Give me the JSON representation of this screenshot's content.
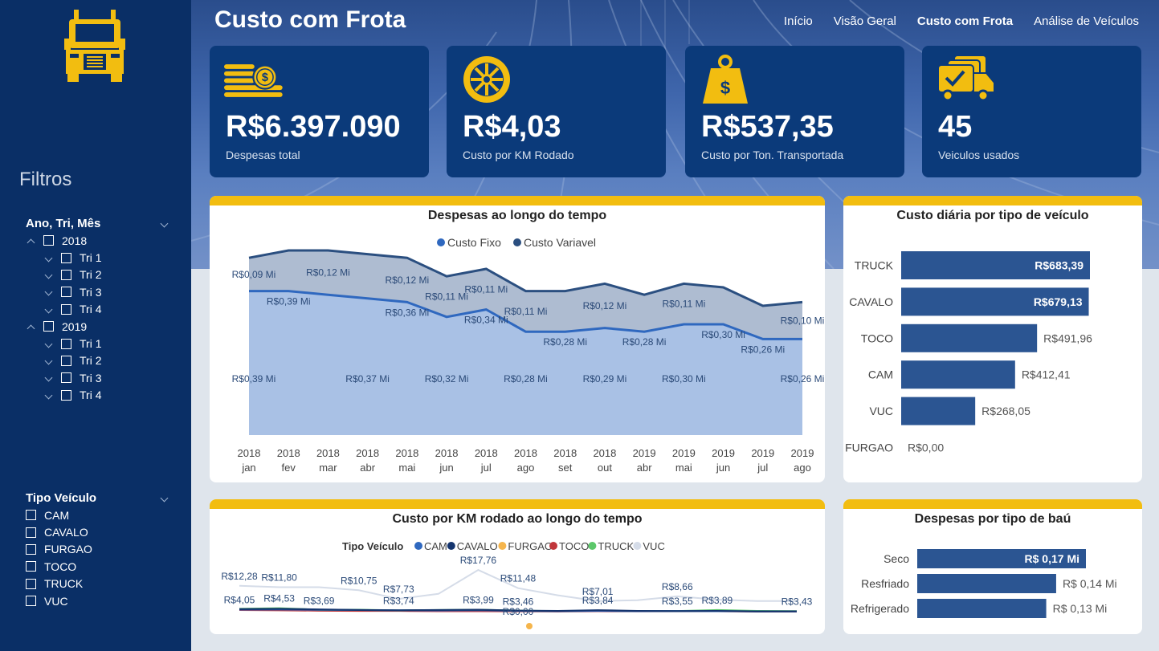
{
  "header": {
    "title": "Custo com Frota",
    "nav": [
      "Início",
      "Visão Geral",
      "Custo com Frota",
      "Análise de Veículos"
    ],
    "active_nav": "Custo com Frota"
  },
  "sidebar": {
    "filters_title": "Filtros",
    "date_filter": {
      "label": "Ano, Tri, Mês",
      "years": [
        {
          "label": "2018",
          "quarters": [
            "Tri 1",
            "Tri 2",
            "Tri 3",
            "Tri 4"
          ]
        },
        {
          "label": "2019",
          "quarters": [
            "Tri 1",
            "Tri 2",
            "Tri 3",
            "Tri 4"
          ]
        }
      ]
    },
    "vehicle_filter": {
      "label": "Tipo Veículo",
      "options": [
        "CAM",
        "CAVALO",
        "FURGAO",
        "TOCO",
        "TRUCK",
        "VUC"
      ]
    }
  },
  "kpis": [
    {
      "value": "R$6.397.090",
      "label": "Despesas total",
      "icon": "coins-icon"
    },
    {
      "value": "R$4,03",
      "label": "Custo por KM Rodado",
      "icon": "tire-icon"
    },
    {
      "value": "R$537,35",
      "label": "Custo por Ton. Transportada",
      "icon": "weight-icon"
    },
    {
      "value": "45",
      "label": "Veiculos usados",
      "icon": "trucks-check-icon"
    }
  ],
  "colors": {
    "sidebar": "#0a2f66",
    "kpi_card": "#0b3a7a",
    "accent_bar": "#f2bd10",
    "bar": "#2b5592",
    "custo_fixo": "#2f68bf",
    "custo_variavel": "#2b4f80"
  },
  "chart_data": [
    {
      "type": "area",
      "title": "Despesas ao longo do tempo",
      "legend_position": "top-center",
      "x": [
        "2018 jan",
        "2018 fev",
        "2018 mar",
        "2018 abr",
        "2018 mai",
        "2018 jun",
        "2018 jul",
        "2018 ago",
        "2018 set",
        "2018 out",
        "2019 abr",
        "2019 mai",
        "2019 jun",
        "2019 jul",
        "2019 ago"
      ],
      "x_labels": [
        [
          "2018",
          "jan"
        ],
        [
          "2018",
          "fev"
        ],
        [
          "2018",
          "mar"
        ],
        [
          "2018",
          "abr"
        ],
        [
          "2018",
          "mai"
        ],
        [
          "2018",
          "jun"
        ],
        [
          "2018",
          "jul"
        ],
        [
          "2018",
          "ago"
        ],
        [
          "2018",
          "set"
        ],
        [
          "2018",
          "out"
        ],
        [
          "2019",
          "abr"
        ],
        [
          "2019",
          "mai"
        ],
        [
          "2019",
          "jun"
        ],
        [
          "2019",
          "jul"
        ],
        [
          "2019",
          "ago"
        ]
      ],
      "stacked": true,
      "series": [
        {
          "name": "Custo Fixo",
          "color": "#2f68bf",
          "values": [
            0.39,
            0.39,
            0.38,
            0.37,
            0.36,
            0.32,
            0.34,
            0.28,
            0.28,
            0.29,
            0.28,
            0.3,
            0.3,
            0.26,
            0.26
          ]
        },
        {
          "name": "Custo Variavel",
          "color": "#2b4f80",
          "values": [
            0.09,
            0.11,
            0.12,
            0.12,
            0.12,
            0.11,
            0.11,
            0.11,
            0.11,
            0.12,
            0.1,
            0.11,
            0.1,
            0.09,
            0.1
          ]
        }
      ],
      "data_labels": [
        {
          "series": "Custo Variavel",
          "idx": 0,
          "text": "R$0,09 Mi"
        },
        {
          "series": "Custo Variavel",
          "idx": 2,
          "text": "R$0,12 Mi"
        },
        {
          "series": "Custo Variavel",
          "idx": 4,
          "text": "R$0,12 Mi"
        },
        {
          "series": "Custo Variavel",
          "idx": 5,
          "text": "R$0,11 Mi"
        },
        {
          "series": "Custo Variavel",
          "idx": 6,
          "text": "R$0,11 Mi"
        },
        {
          "series": "Custo Variavel",
          "idx": 7,
          "text": "R$0,11 Mi"
        },
        {
          "series": "Custo Variavel",
          "idx": 9,
          "text": "R$0,12 Mi"
        },
        {
          "series": "Custo Variavel",
          "idx": 11,
          "text": "R$0,11 Mi"
        },
        {
          "series": "Custo Variavel",
          "idx": 14,
          "text": "R$0,10 Mi"
        },
        {
          "series": "Custo Fixo",
          "idx": 0,
          "text": "R$0,39 Mi"
        },
        {
          "series": "Custo Fixo",
          "idx": 1,
          "text": "R$0,39 Mi"
        },
        {
          "series": "Custo Fixo",
          "idx": 3,
          "text": "R$0,37 Mi"
        },
        {
          "series": "Custo Fixo",
          "idx": 4,
          "text": "R$0,36 Mi"
        },
        {
          "series": "Custo Fixo",
          "idx": 5,
          "text": "R$0,32 Mi"
        },
        {
          "series": "Custo Fixo",
          "idx": 6,
          "text": "R$0,34 Mi"
        },
        {
          "series": "Custo Fixo",
          "idx": 7,
          "text": "R$0,28 Mi"
        },
        {
          "series": "Custo Fixo",
          "idx": 8,
          "text": "R$0,28 Mi"
        },
        {
          "series": "Custo Fixo",
          "idx": 9,
          "text": "R$0,29 Mi"
        },
        {
          "series": "Custo Fixo",
          "idx": 10,
          "text": "R$0,28 Mi"
        },
        {
          "series": "Custo Fixo",
          "idx": 11,
          "text": "R$0,30 Mi"
        },
        {
          "series": "Custo Fixo",
          "idx": 12,
          "text": "R$0,30 Mi"
        },
        {
          "series": "Custo Fixo",
          "idx": 13,
          "text": "R$0,26 Mi"
        },
        {
          "series": "Custo Fixo",
          "idx": 14,
          "text": "R$0,26 Mi"
        }
      ]
    },
    {
      "type": "bar",
      "orientation": "horizontal",
      "title": "Custo diária por tipo de veículo",
      "categories": [
        "TRUCK",
        "CAVALO",
        "TOCO",
        "CAM",
        "VUC",
        "FURGAO"
      ],
      "values": [
        683.39,
        679.13,
        491.96,
        412.41,
        268.05,
        0.0
      ],
      "labels": [
        "R$683,39",
        "R$679,13",
        "R$491,96",
        "R$412,41",
        "R$268,05",
        "R$0,00"
      ],
      "color": "#2b5592"
    },
    {
      "type": "line",
      "title": "Custo por KM rodado ao longo do tempo",
      "legend_title": "Tipo Veículo",
      "legend_position": "top-center",
      "series": [
        {
          "name": "CAM",
          "color": "#2f68bf",
          "values": [
            4.05,
            4.1,
            4.0,
            3.9,
            3.8,
            3.75,
            3.85,
            3.6,
            3.5,
            3.6,
            3.5,
            3.55,
            3.5,
            3.45,
            3.43
          ]
        },
        {
          "name": "CAVALO",
          "color": "#14346e",
          "values": [
            4.2,
            4.3,
            4.1,
            3.9,
            3.8,
            3.9,
            3.99,
            3.7,
            3.6,
            3.84,
            3.6,
            3.5,
            3.6,
            3.4,
            3.43
          ]
        },
        {
          "name": "FURGAO",
          "color": "#f5b54c",
          "values": [
            null,
            null,
            null,
            null,
            null,
            null,
            null,
            0.0,
            null,
            null,
            null,
            null,
            null,
            null,
            null
          ]
        },
        {
          "name": "TOCO",
          "color": "#c0363a",
          "values": [
            3.9,
            3.8,
            3.69,
            3.6,
            3.6,
            3.5,
            3.5,
            3.46,
            3.4,
            3.5,
            3.45,
            3.5,
            3.5,
            3.4,
            3.4
          ]
        },
        {
          "name": "TRUCK",
          "color": "#5cc76a",
          "values": [
            4.3,
            4.53,
            4.0,
            4.0,
            3.74,
            3.9,
            4.0,
            3.7,
            3.5,
            3.7,
            3.5,
            3.55,
            3.89,
            3.6,
            3.5
          ]
        },
        {
          "name": "VUC",
          "color": "#d5dce8",
          "values": [
            12.28,
            11.8,
            11.8,
            10.75,
            7.73,
            9.5,
            17.76,
            11.48,
            9.0,
            7.01,
            7.3,
            8.66,
            7.5,
            7.0,
            7.0
          ]
        }
      ],
      "data_labels": [
        {
          "series": "VUC",
          "idx": 0,
          "text": "R$12,28"
        },
        {
          "series": "VUC",
          "idx": 1,
          "text": "R$11,80"
        },
        {
          "series": "VUC",
          "idx": 3,
          "text": "R$10,75"
        },
        {
          "series": "VUC",
          "idx": 4,
          "text": "R$7,73"
        },
        {
          "series": "VUC",
          "idx": 6,
          "text": "R$17,76"
        },
        {
          "series": "VUC",
          "idx": 7,
          "text": "R$11,48"
        },
        {
          "series": "VUC",
          "idx": 9,
          "text": "R$7,01"
        },
        {
          "series": "VUC",
          "idx": 11,
          "text": "R$8,66"
        },
        {
          "series": "CAM",
          "idx": 0,
          "text": "R$4,05"
        },
        {
          "series": "TRUCK",
          "idx": 1,
          "text": "R$4,53"
        },
        {
          "series": "TOCO",
          "idx": 2,
          "text": "R$3,69"
        },
        {
          "series": "TRUCK",
          "idx": 4,
          "text": "R$3,74"
        },
        {
          "series": "CAVALO",
          "idx": 6,
          "text": "R$3,99"
        },
        {
          "series": "TOCO",
          "idx": 7,
          "text": "R$3,46"
        },
        {
          "series": "FURGAO",
          "idx": 7,
          "text": "R$0,00"
        },
        {
          "series": "CAVALO",
          "idx": 9,
          "text": "R$3,84"
        },
        {
          "series": "CAM",
          "idx": 11,
          "text": "R$3,55"
        },
        {
          "series": "TRUCK",
          "idx": 12,
          "text": "R$3,89"
        },
        {
          "series": "CAM",
          "idx": 14,
          "text": "R$3,43"
        }
      ]
    },
    {
      "type": "bar",
      "orientation": "horizontal",
      "title": "Despesas por tipo de baú",
      "categories": [
        "Seco",
        "Resfriado",
        "Refrigerado"
      ],
      "values": [
        0.17,
        0.14,
        0.13
      ],
      "labels": [
        "R$ 0,17 Mi",
        "R$ 0,14 Mi",
        "R$ 0,13 Mi"
      ],
      "color": "#2b5592"
    }
  ]
}
